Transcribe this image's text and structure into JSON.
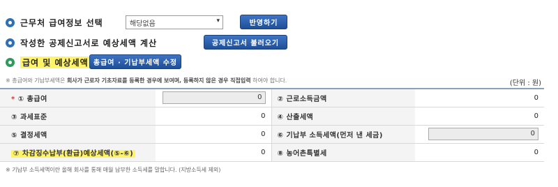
{
  "sections": [
    {
      "label": "근무처 급여정보 선택"
    },
    {
      "label": "작성한 공제신고서로 예상세액 계산"
    },
    {
      "label": "급여 및 예상세액"
    }
  ],
  "workplace_select": {
    "value": "해당없음"
  },
  "buttons": {
    "apply": "반영하기",
    "load_deduction": "공제신고서 불러오기",
    "edit_salary": "총급여 · 기납부세액 수정"
  },
  "notice": {
    "prefix": "※ 총급여와 기납부세액은 ",
    "emphasis": "회사가 근로자 기초자료를 등록한 경우에 보여며, 등록하지 않은 경우 직접입력",
    "suffix": " 하여야 합니다."
  },
  "unit_label": "(단위 : 원)",
  "table": {
    "required_mark": "*",
    "rows": [
      {
        "left_label": "① 총급여",
        "left_value": "0",
        "right_label": "② 근로소득금액",
        "right_value": "0"
      },
      {
        "left_label": "③ 과세표준",
        "left_value": "0",
        "right_label": "④ 산출세액",
        "right_value": "0"
      },
      {
        "left_label": "⑤ 결정세액",
        "left_value": "0",
        "right_label": "⑥ 기납부 소득세액(먼저 낸 세금)",
        "right_value": "0"
      },
      {
        "left_label": "⑦ 차감징수납부(환급)예상세액(⑤-⑥)",
        "left_value": "0",
        "right_label": "⑧ 농어촌특별세",
        "right_value": "0"
      }
    ]
  },
  "footer_note": "※ 기납부 소득세액이란 올해 회사를 통해 매월 납부한 소득세를 말합니다. (지방소득세 제외)",
  "colors": {
    "button_blue": "#2a5eab",
    "highlight": "#fff36a",
    "bullet_blue": "#2e6fb5",
    "bullet_green": "#2e9a5e"
  }
}
